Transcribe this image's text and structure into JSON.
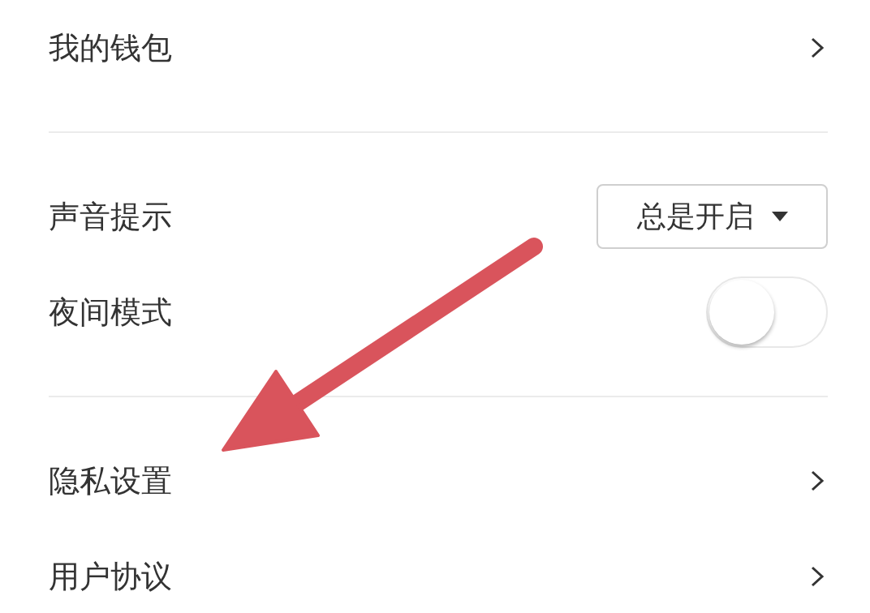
{
  "sections": [
    {
      "rows": [
        {
          "kind": "link",
          "label": "我的钱包"
        }
      ]
    },
    {
      "rows": [
        {
          "kind": "dropdown",
          "label": "声音提示",
          "value": "总是开启"
        },
        {
          "kind": "toggle",
          "label": "夜间模式",
          "on": false
        }
      ]
    },
    {
      "rows": [
        {
          "kind": "link",
          "label": "隐私设置"
        },
        {
          "kind": "link",
          "label": "用户协议"
        }
      ]
    }
  ]
}
